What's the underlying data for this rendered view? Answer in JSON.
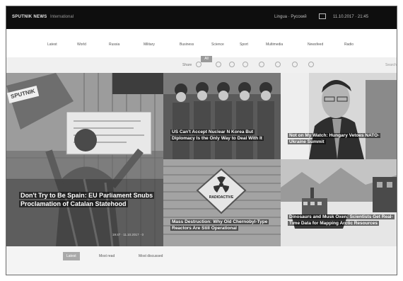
{
  "topbar": {
    "logo": "SPUTNIK NEWS",
    "edition": "International",
    "language": "Lingua · Русский",
    "date": "11.10.2017 · 21:45"
  },
  "nav": {
    "items": [
      "Latest",
      "World",
      "Russia",
      "Military",
      "Business",
      "Science",
      "Sport",
      "Multimedia",
      "Newsfeed",
      "Radio"
    ],
    "active_tab": "All"
  },
  "share": {
    "label": "Share",
    "icons": [
      "facebook-icon",
      "twitter-icon",
      "vk-icon",
      "odnoklassniki-icon",
      "telegram-icon",
      "email-icon",
      "print-icon"
    ],
    "search_label": "Search"
  },
  "tiles": {
    "main": {
      "brand": "SPUTNIK",
      "headline": "Don't Try to Be Spain: EU Parliament Snubs Proclamation of Catalan Statehood",
      "meta": "19:47 · 11.10.2017 · 0"
    },
    "korea": {
      "headline": "US Can't Accept Nuclear N Korea But Diplomacy Is the Only Way to Deal With It"
    },
    "ukraine": {
      "headline": "Not on My Watch: Hungary Vetoes NATO-Ukraine Summit"
    },
    "radioactive": {
      "sign": "RADIOACTIVE",
      "headline": "Mass Destruction: Why Old Chernobyl-Type Reactors Are Still Operational"
    },
    "arctic": {
      "headline": "Dinosaurs and Musk Oxen: Scientists Get Real-Time Data for Mapping Arctic Resources"
    }
  },
  "tabs": [
    "Latest",
    "Most read",
    "Most discussed"
  ]
}
